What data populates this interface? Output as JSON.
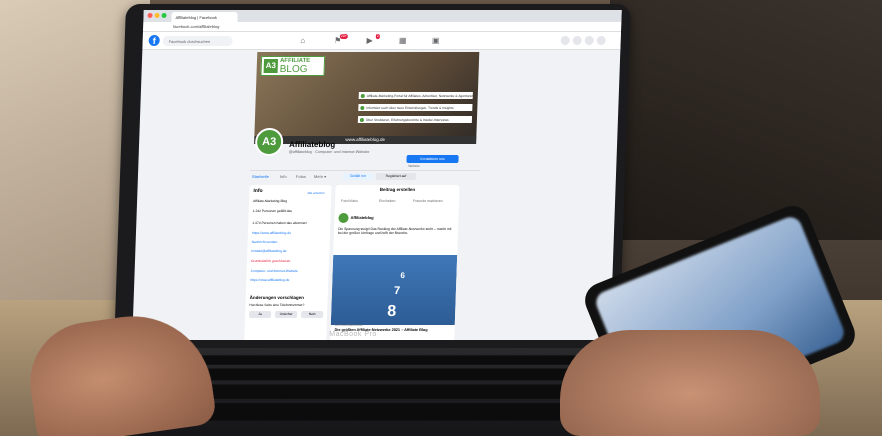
{
  "browser": {
    "tab_title": "Affiliateblog | Facebook",
    "url": "facebook.com/affiliateblog",
    "search_placeholder": "Facebook durchsuchen",
    "badge_1": "20+",
    "badge_2": "2"
  },
  "cover": {
    "logo_mark": "A3",
    "logo_top": "AFFILIATE",
    "logo_bottom": "BLOG",
    "bullets": [
      "Affiliate-Marketing-Portal für Affiliates, Advertiser, Netzwerke & Agenturen",
      "Informiert euch über neue Entwicklungen, Trends & Insights",
      "Über Strukturen, Erfahrungsberichte & Insider-Interviews"
    ],
    "url": "www.affiliateblog.de"
  },
  "profile": {
    "avatar": "A3",
    "name": "Affiliateblog",
    "subtitle": "@affiliateblog · Computer- und Internet-Website",
    "contact_button": "Kontaktiere uns",
    "contact_sub": "Website"
  },
  "tabs": [
    "Startseite",
    "Info",
    "Fotos",
    "Mehr ▾"
  ],
  "actions": {
    "like": "Gefällt mir",
    "register": "Registriert auf"
  },
  "info": {
    "title": "Info",
    "all": "Alle ansehen",
    "rows": [
      "Affiliate-Marketing-Blog",
      "1.242 Personen gefällt das",
      "1.374 Personen haben das abonniert",
      "https://www.affiliateblog.de",
      "Nachricht senden",
      "kontakt@affiliateblog.de",
      "Grundsätzlich geschlossen",
      "Computer- und Internet-Website",
      "https://www.affiliateblog.de"
    ],
    "suggest_title": "Änderungen vorschlagen",
    "suggest_question": "Hat diese Seite eine Telefonnummer?",
    "buttons": [
      "Ja",
      "Unsicher",
      "Nein"
    ]
  },
  "post": {
    "header": "Beitrag erstellen",
    "actions": [
      "Foto/Video",
      "Eincheken",
      "Freunde markieren"
    ],
    "author": "Affiliateblog",
    "text": "Die Spannung steigt! Das Ranking der Affiliate-Netzwerke steht – macht mit bei der großen Umfrage und helft der Branche.",
    "lane_numbers": [
      "6",
      "7",
      "8"
    ],
    "domain": "AFFILIATEBLOG.DE",
    "caption": "Die größten Affiliate-Netzwerke 2021 – Affiliate Blog"
  },
  "laptop_brand": "MacBook Pro"
}
